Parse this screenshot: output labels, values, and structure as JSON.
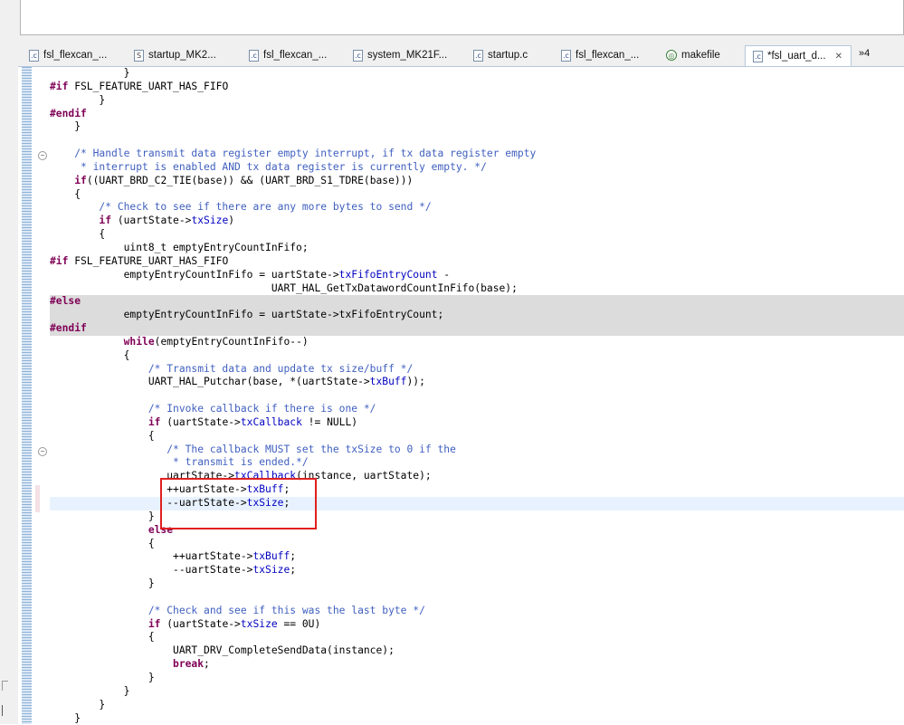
{
  "tabs": [
    {
      "label": "fsl_flexcan_...",
      "icon": "c-file-icon"
    },
    {
      "label": "startup_MK2...",
      "icon": "s-file-icon"
    },
    {
      "label": "fsl_flexcan_...",
      "icon": "c-file-icon"
    },
    {
      "label": "system_MK21F...",
      "icon": "c-file-icon"
    },
    {
      "label": "startup.c",
      "icon": "c-file-icon"
    },
    {
      "label": "fsl_flexcan_...",
      "icon": "c-file-icon"
    },
    {
      "label": "makefile",
      "icon": "makefile-icon"
    },
    {
      "label": "*fsl_uart_d...",
      "icon": "c-file-icon",
      "active": true
    }
  ],
  "tab_overflow": "»4",
  "code_lines": [
    [
      [
        "",
        "            }"
      ]
    ],
    [
      [
        "kw",
        "#if"
      ],
      [
        "",
        " FSL_FEATURE_UART_HAS_FIFO"
      ]
    ],
    [
      [
        "",
        "        }"
      ]
    ],
    [
      [
        "kw",
        "#endif"
      ]
    ],
    [
      [
        "",
        "    }"
      ]
    ],
    [
      [
        "",
        ""
      ]
    ],
    [
      [
        "cm",
        "    /* Handle transmit data register empty interrupt, if tx data register empty"
      ]
    ],
    [
      [
        "cm",
        "     * interrupt is enabled AND tx data register is currently empty. */"
      ]
    ],
    [
      [
        "",
        "    "
      ],
      [
        "kw",
        "if"
      ],
      [
        "",
        "((UART_BRD_C2_TIE(base)) && (UART_BRD_S1_TDRE(base)))"
      ]
    ],
    [
      [
        "",
        "    {"
      ]
    ],
    [
      [
        "cm",
        "        /* Check to see if there are any more bytes to send */"
      ]
    ],
    [
      [
        "",
        "        "
      ],
      [
        "kw",
        "if"
      ],
      [
        "",
        " (uartState->"
      ],
      [
        "fd",
        "txSize"
      ],
      [
        "",
        ")"
      ]
    ],
    [
      [
        "",
        "        {"
      ]
    ],
    [
      [
        "",
        "            uint8_t emptyEntryCountInFifo;"
      ]
    ],
    [
      [
        "kw",
        "#if"
      ],
      [
        "",
        " FSL_FEATURE_UART_HAS_FIFO"
      ]
    ],
    [
      [
        "",
        "            emptyEntryCountInFifo = uartState->"
      ],
      [
        "fd",
        "txFifoEntryCount"
      ],
      [
        "",
        " -"
      ]
    ],
    [
      [
        "",
        "                                    UART_HAL_GetTxDatawordCountInFifo(base);"
      ]
    ],
    [
      [
        "kw",
        "#else"
      ]
    ],
    [
      [
        "",
        "            emptyEntryCountInFifo = uartState->txFifoEntryCount;"
      ]
    ],
    [
      [
        "kw",
        "#endif"
      ]
    ],
    [
      [
        "",
        "            "
      ],
      [
        "kw",
        "while"
      ],
      [
        "",
        "(emptyEntryCountInFifo--)"
      ]
    ],
    [
      [
        "",
        "            {"
      ]
    ],
    [
      [
        "cm",
        "                /* Transmit data and update tx size/buff */"
      ]
    ],
    [
      [
        "",
        "                UART_HAL_Putchar(base, *(uartState->"
      ],
      [
        "fd",
        "txBuff"
      ],
      [
        "",
        "));"
      ]
    ],
    [
      [
        "",
        ""
      ]
    ],
    [
      [
        "cm",
        "                /* Invoke callback if there is one */"
      ]
    ],
    [
      [
        "",
        "                "
      ],
      [
        "kw",
        "if"
      ],
      [
        "",
        " (uartState->"
      ],
      [
        "fd",
        "txCallback"
      ],
      [
        "",
        " != NULL)"
      ]
    ],
    [
      [
        "",
        "                {"
      ]
    ],
    [
      [
        "cm",
        "                   /* The callback MUST set the txSize to 0 if the"
      ]
    ],
    [
      [
        "cm",
        "                    * transmit is ended.*/"
      ]
    ],
    [
      [
        "",
        "                   uartState->"
      ],
      [
        "fd",
        "txCallback"
      ],
      [
        "",
        "(instance, uartState);"
      ]
    ],
    [
      [
        "",
        "                   ++uartState->"
      ],
      [
        "fd",
        "txBuff"
      ],
      [
        "",
        ";"
      ]
    ],
    [
      [
        "",
        "                   --uartState->"
      ],
      [
        "fd",
        "txSize"
      ],
      [
        "",
        ";"
      ]
    ],
    [
      [
        "",
        "                }"
      ]
    ],
    [
      [
        "",
        "                "
      ],
      [
        "kw",
        "else"
      ]
    ],
    [
      [
        "",
        "                {"
      ]
    ],
    [
      [
        "",
        "                    ++uartState->"
      ],
      [
        "fd",
        "txBuff"
      ],
      [
        "",
        ";"
      ]
    ],
    [
      [
        "",
        "                    --uartState->"
      ],
      [
        "fd",
        "txSize"
      ],
      [
        "",
        ";"
      ]
    ],
    [
      [
        "",
        "                }"
      ]
    ],
    [
      [
        "",
        ""
      ]
    ],
    [
      [
        "cm",
        "                /* Check and see if this was the last byte */"
      ]
    ],
    [
      [
        "",
        "                "
      ],
      [
        "kw",
        "if"
      ],
      [
        "",
        " (uartState->"
      ],
      [
        "fd",
        "txSize"
      ],
      [
        "",
        " == 0U)"
      ]
    ],
    [
      [
        "",
        "                {"
      ]
    ],
    [
      [
        "",
        "                    UART_DRV_CompleteSendData(instance);"
      ]
    ],
    [
      [
        "",
        "                    "
      ],
      [
        "kw",
        "break"
      ],
      [
        "",
        ";"
      ]
    ],
    [
      [
        "",
        "                }"
      ]
    ],
    [
      [
        "",
        "            }"
      ]
    ],
    [
      [
        "",
        "        }"
      ]
    ],
    [
      [
        "",
        "    }"
      ]
    ]
  ],
  "inactive_lines": [
    17,
    18,
    19
  ],
  "current_line": 32,
  "colors": {
    "keyword": "#7f0055",
    "comment": "#3f5fbf",
    "field": "#0000c0",
    "inactive_bg": "#dcdcdc",
    "current_line_bg": "#e8f2fe",
    "annotation_box": "#e01f1f"
  }
}
